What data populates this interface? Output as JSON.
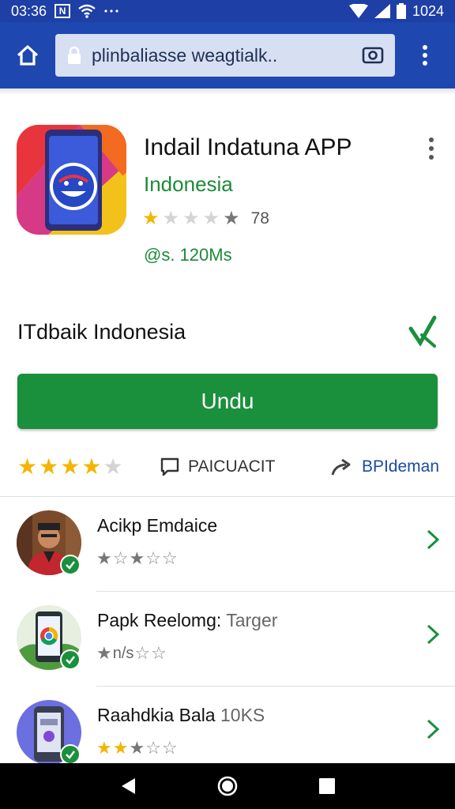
{
  "status_bar": {
    "time": "03:36",
    "n_badge": "N",
    "battery_level": "1024"
  },
  "browser": {
    "url": "plinbaliasse weagtialk..",
    "icons": [
      "home-icon",
      "lock-icon",
      "camera-icon",
      "more-vert-icon"
    ]
  },
  "app": {
    "title": "Indail Indatuna APP",
    "developer": "Indonesia",
    "rating_stars": 1,
    "rating_count": "78",
    "size": "@s. 120Ms"
  },
  "section": {
    "title": "ITdbaik Indonesia"
  },
  "install": {
    "label": "Undu"
  },
  "actions": {
    "rating_stars": 4,
    "comment_label": "PAICUACIT",
    "share_label": "BPIdeman"
  },
  "list": [
    {
      "title": "Acikp Emdaice",
      "title_dim": "",
      "rating_stars": 1,
      "rating_prefix": ""
    },
    {
      "title": "Papk Reelomg:",
      "title_dim": " Targer",
      "rating_stars": 1,
      "rating_prefix": "n/s"
    },
    {
      "title": "Raahdkia Bala",
      "title_dim": " 10KS",
      "rating_stars": 2,
      "rating_prefix": ""
    }
  ],
  "colors": {
    "status_bar": "#1d3fa6",
    "url_bar": "#1f47b0",
    "accent_green": "#1a8f3c",
    "star": "#f4b400",
    "link_blue": "#1a4ca3"
  }
}
